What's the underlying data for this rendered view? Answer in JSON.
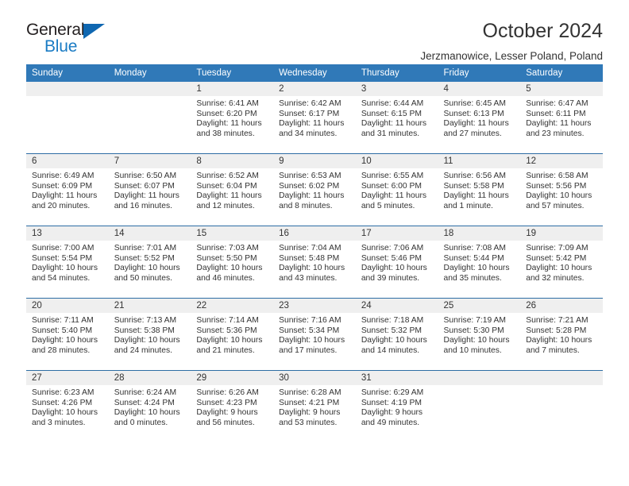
{
  "brand": {
    "name_part1": "General",
    "name_part2": "Blue",
    "triangle_color": "#0f67b1",
    "blue_color": "#1a7bc4"
  },
  "header": {
    "title": "October 2024",
    "subtitle": "Jerzmanowice, Lesser Poland, Poland"
  },
  "theme": {
    "header_bg": "#3079b8",
    "row_divider": "#2e6da4",
    "daynum_bg": "#efefef",
    "text": "#333333"
  },
  "calendar": {
    "weekday_headers": [
      "Sunday",
      "Monday",
      "Tuesday",
      "Wednesday",
      "Thursday",
      "Friday",
      "Saturday"
    ],
    "weeks": [
      [
        {
          "day": "",
          "empty": true,
          "sunrise": "",
          "sunset": "",
          "daylight_line1": "",
          "daylight_line2": ""
        },
        {
          "day": "",
          "empty": true,
          "sunrise": "",
          "sunset": "",
          "daylight_line1": "",
          "daylight_line2": ""
        },
        {
          "day": "1",
          "empty": false,
          "sunrise": "Sunrise: 6:41 AM",
          "sunset": "Sunset: 6:20 PM",
          "daylight_line1": "Daylight: 11 hours",
          "daylight_line2": "and 38 minutes."
        },
        {
          "day": "2",
          "empty": false,
          "sunrise": "Sunrise: 6:42 AM",
          "sunset": "Sunset: 6:17 PM",
          "daylight_line1": "Daylight: 11 hours",
          "daylight_line2": "and 34 minutes."
        },
        {
          "day": "3",
          "empty": false,
          "sunrise": "Sunrise: 6:44 AM",
          "sunset": "Sunset: 6:15 PM",
          "daylight_line1": "Daylight: 11 hours",
          "daylight_line2": "and 31 minutes."
        },
        {
          "day": "4",
          "empty": false,
          "sunrise": "Sunrise: 6:45 AM",
          "sunset": "Sunset: 6:13 PM",
          "daylight_line1": "Daylight: 11 hours",
          "daylight_line2": "and 27 minutes."
        },
        {
          "day": "5",
          "empty": false,
          "sunrise": "Sunrise: 6:47 AM",
          "sunset": "Sunset: 6:11 PM",
          "daylight_line1": "Daylight: 11 hours",
          "daylight_line2": "and 23 minutes."
        }
      ],
      [
        {
          "day": "6",
          "empty": false,
          "sunrise": "Sunrise: 6:49 AM",
          "sunset": "Sunset: 6:09 PM",
          "daylight_line1": "Daylight: 11 hours",
          "daylight_line2": "and 20 minutes."
        },
        {
          "day": "7",
          "empty": false,
          "sunrise": "Sunrise: 6:50 AM",
          "sunset": "Sunset: 6:07 PM",
          "daylight_line1": "Daylight: 11 hours",
          "daylight_line2": "and 16 minutes."
        },
        {
          "day": "8",
          "empty": false,
          "sunrise": "Sunrise: 6:52 AM",
          "sunset": "Sunset: 6:04 PM",
          "daylight_line1": "Daylight: 11 hours",
          "daylight_line2": "and 12 minutes."
        },
        {
          "day": "9",
          "empty": false,
          "sunrise": "Sunrise: 6:53 AM",
          "sunset": "Sunset: 6:02 PM",
          "daylight_line1": "Daylight: 11 hours",
          "daylight_line2": "and 8 minutes."
        },
        {
          "day": "10",
          "empty": false,
          "sunrise": "Sunrise: 6:55 AM",
          "sunset": "Sunset: 6:00 PM",
          "daylight_line1": "Daylight: 11 hours",
          "daylight_line2": "and 5 minutes."
        },
        {
          "day": "11",
          "empty": false,
          "sunrise": "Sunrise: 6:56 AM",
          "sunset": "Sunset: 5:58 PM",
          "daylight_line1": "Daylight: 11 hours",
          "daylight_line2": "and 1 minute."
        },
        {
          "day": "12",
          "empty": false,
          "sunrise": "Sunrise: 6:58 AM",
          "sunset": "Sunset: 5:56 PM",
          "daylight_line1": "Daylight: 10 hours",
          "daylight_line2": "and 57 minutes."
        }
      ],
      [
        {
          "day": "13",
          "empty": false,
          "sunrise": "Sunrise: 7:00 AM",
          "sunset": "Sunset: 5:54 PM",
          "daylight_line1": "Daylight: 10 hours",
          "daylight_line2": "and 54 minutes."
        },
        {
          "day": "14",
          "empty": false,
          "sunrise": "Sunrise: 7:01 AM",
          "sunset": "Sunset: 5:52 PM",
          "daylight_line1": "Daylight: 10 hours",
          "daylight_line2": "and 50 minutes."
        },
        {
          "day": "15",
          "empty": false,
          "sunrise": "Sunrise: 7:03 AM",
          "sunset": "Sunset: 5:50 PM",
          "daylight_line1": "Daylight: 10 hours",
          "daylight_line2": "and 46 minutes."
        },
        {
          "day": "16",
          "empty": false,
          "sunrise": "Sunrise: 7:04 AM",
          "sunset": "Sunset: 5:48 PM",
          "daylight_line1": "Daylight: 10 hours",
          "daylight_line2": "and 43 minutes."
        },
        {
          "day": "17",
          "empty": false,
          "sunrise": "Sunrise: 7:06 AM",
          "sunset": "Sunset: 5:46 PM",
          "daylight_line1": "Daylight: 10 hours",
          "daylight_line2": "and 39 minutes."
        },
        {
          "day": "18",
          "empty": false,
          "sunrise": "Sunrise: 7:08 AM",
          "sunset": "Sunset: 5:44 PM",
          "daylight_line1": "Daylight: 10 hours",
          "daylight_line2": "and 35 minutes."
        },
        {
          "day": "19",
          "empty": false,
          "sunrise": "Sunrise: 7:09 AM",
          "sunset": "Sunset: 5:42 PM",
          "daylight_line1": "Daylight: 10 hours",
          "daylight_line2": "and 32 minutes."
        }
      ],
      [
        {
          "day": "20",
          "empty": false,
          "sunrise": "Sunrise: 7:11 AM",
          "sunset": "Sunset: 5:40 PM",
          "daylight_line1": "Daylight: 10 hours",
          "daylight_line2": "and 28 minutes."
        },
        {
          "day": "21",
          "empty": false,
          "sunrise": "Sunrise: 7:13 AM",
          "sunset": "Sunset: 5:38 PM",
          "daylight_line1": "Daylight: 10 hours",
          "daylight_line2": "and 24 minutes."
        },
        {
          "day": "22",
          "empty": false,
          "sunrise": "Sunrise: 7:14 AM",
          "sunset": "Sunset: 5:36 PM",
          "daylight_line1": "Daylight: 10 hours",
          "daylight_line2": "and 21 minutes."
        },
        {
          "day": "23",
          "empty": false,
          "sunrise": "Sunrise: 7:16 AM",
          "sunset": "Sunset: 5:34 PM",
          "daylight_line1": "Daylight: 10 hours",
          "daylight_line2": "and 17 minutes."
        },
        {
          "day": "24",
          "empty": false,
          "sunrise": "Sunrise: 7:18 AM",
          "sunset": "Sunset: 5:32 PM",
          "daylight_line1": "Daylight: 10 hours",
          "daylight_line2": "and 14 minutes."
        },
        {
          "day": "25",
          "empty": false,
          "sunrise": "Sunrise: 7:19 AM",
          "sunset": "Sunset: 5:30 PM",
          "daylight_line1": "Daylight: 10 hours",
          "daylight_line2": "and 10 minutes."
        },
        {
          "day": "26",
          "empty": false,
          "sunrise": "Sunrise: 7:21 AM",
          "sunset": "Sunset: 5:28 PM",
          "daylight_line1": "Daylight: 10 hours",
          "daylight_line2": "and 7 minutes."
        }
      ],
      [
        {
          "day": "27",
          "empty": false,
          "sunrise": "Sunrise: 6:23 AM",
          "sunset": "Sunset: 4:26 PM",
          "daylight_line1": "Daylight: 10 hours",
          "daylight_line2": "and 3 minutes."
        },
        {
          "day": "28",
          "empty": false,
          "sunrise": "Sunrise: 6:24 AM",
          "sunset": "Sunset: 4:24 PM",
          "daylight_line1": "Daylight: 10 hours",
          "daylight_line2": "and 0 minutes."
        },
        {
          "day": "29",
          "empty": false,
          "sunrise": "Sunrise: 6:26 AM",
          "sunset": "Sunset: 4:23 PM",
          "daylight_line1": "Daylight: 9 hours",
          "daylight_line2": "and 56 minutes."
        },
        {
          "day": "30",
          "empty": false,
          "sunrise": "Sunrise: 6:28 AM",
          "sunset": "Sunset: 4:21 PM",
          "daylight_line1": "Daylight: 9 hours",
          "daylight_line2": "and 53 minutes."
        },
        {
          "day": "31",
          "empty": false,
          "sunrise": "Sunrise: 6:29 AM",
          "sunset": "Sunset: 4:19 PM",
          "daylight_line1": "Daylight: 9 hours",
          "daylight_line2": "and 49 minutes."
        },
        {
          "day": "",
          "empty": true,
          "sunrise": "",
          "sunset": "",
          "daylight_line1": "",
          "daylight_line2": ""
        },
        {
          "day": "",
          "empty": true,
          "sunrise": "",
          "sunset": "",
          "daylight_line1": "",
          "daylight_line2": ""
        }
      ]
    ]
  }
}
